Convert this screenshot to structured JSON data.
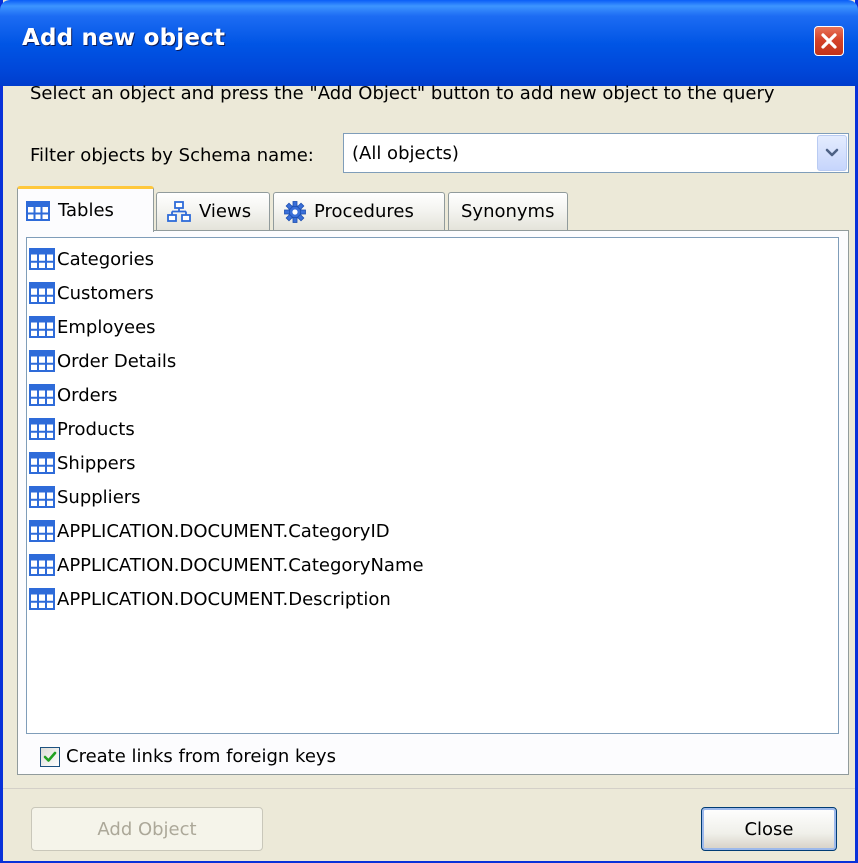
{
  "window": {
    "title": "Add new object"
  },
  "instructions": "Select an object and press the \"Add Object\" button to add new object to the query",
  "filter": {
    "label": "Filter objects by Schema name:",
    "selected": "(All objects)"
  },
  "tabs": [
    {
      "label": "Tables",
      "icon": "table-icon",
      "active": true
    },
    {
      "label": "Views",
      "icon": "view-icon",
      "active": false
    },
    {
      "label": "Procedures",
      "icon": "procedure-gear-icon",
      "active": false
    },
    {
      "label": "Synonyms",
      "icon": "",
      "active": false
    }
  ],
  "objects": [
    "Categories",
    "Customers",
    "Employees",
    "Order Details",
    "Orders",
    "Products",
    "Shippers",
    "Suppliers",
    "APPLICATION.DOCUMENT.CategoryID",
    "APPLICATION.DOCUMENT.CategoryName",
    "APPLICATION.DOCUMENT.Description"
  ],
  "options": {
    "create_links_label": "Create links from foreign keys",
    "create_links_checked": true
  },
  "buttons": {
    "add_object": "Add Object",
    "close": "Close"
  },
  "colors": {
    "titlebar": "#0055E5",
    "window_bg": "#ECE9D8",
    "close_button": "#D5432A",
    "tab_active_accent": "#FFC83C",
    "table_icon": "#2E6BD9"
  }
}
